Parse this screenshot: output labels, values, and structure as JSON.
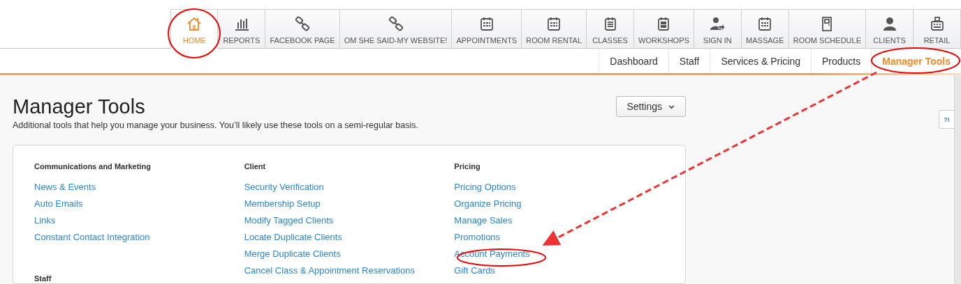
{
  "main_nav": [
    {
      "label": "HOME",
      "selected": true
    },
    {
      "label": "REPORTS",
      "selected": false
    },
    {
      "label": "FACEBOOK PAGE",
      "selected": false
    },
    {
      "label": "OM SHE SAID-MY WEBSITE!",
      "selected": false
    },
    {
      "label": "APPOINTMENTS",
      "selected": false
    },
    {
      "label": "ROOM RENTAL",
      "selected": false
    },
    {
      "label": "CLASSES",
      "selected": false
    },
    {
      "label": "WORKSHOPS",
      "selected": false
    },
    {
      "label": "SIGN IN",
      "selected": false
    },
    {
      "label": "MASSAGE",
      "selected": false
    },
    {
      "label": "ROOM SCHEDULE",
      "selected": false
    },
    {
      "label": "CLIENTS",
      "selected": false
    },
    {
      "label": "RETAIL",
      "selected": false
    }
  ],
  "sub_nav": [
    {
      "label": "Dashboard",
      "selected": false
    },
    {
      "label": "Staff",
      "selected": false
    },
    {
      "label": "Services & Pricing",
      "selected": false
    },
    {
      "label": "Products",
      "selected": false
    },
    {
      "label": "Manager Tools",
      "selected": true
    }
  ],
  "page": {
    "title": "Manager Tools",
    "subtitle": "Additional tools that help you manage your business. You’ll likely use these tools on a semi-regular basis.",
    "settings_button": "Settings",
    "help_button": "?!"
  },
  "sections": [
    {
      "heading": "Communications and Marketing",
      "links": [
        "News & Events",
        "Auto Emails",
        "Links",
        "Constant Contact Integration"
      ]
    },
    {
      "heading": "Client",
      "links": [
        "Security Verification",
        "Membership Setup",
        "Modify Tagged Clients",
        "Locate Duplicate Clients",
        "Merge Duplicate Clients",
        "Cancel Class & Appointment Reservations"
      ]
    },
    {
      "heading": "Pricing",
      "links": [
        "Pricing Options",
        "Organize Pricing",
        "Manage Sales",
        "Promotions",
        "Account Payments",
        "Gift Cards"
      ]
    }
  ],
  "next_section": {
    "heading": "Staff"
  }
}
